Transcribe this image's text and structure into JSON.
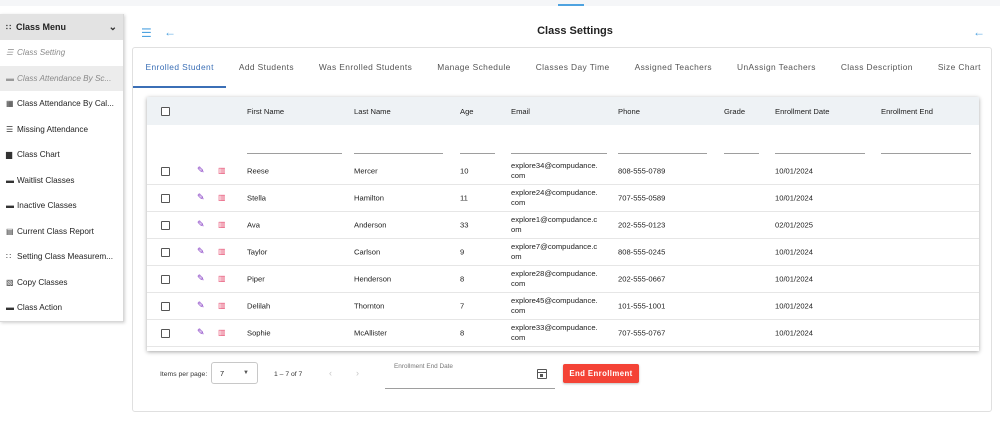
{
  "sidebar": {
    "header": {
      "icon": "grid-icon",
      "label": "Class Menu",
      "chevron": "chevron-down-icon"
    },
    "items": [
      {
        "icon": "list-icon",
        "label": "Class Setting",
        "muted": true
      },
      {
        "icon": "card-icon",
        "label": "Class Attendance By Sc...",
        "muted": true
      },
      {
        "icon": "calendar-icon",
        "label": "Class Attendance By Cal..."
      },
      {
        "icon": "list-icon",
        "label": "Missing Attendance"
      },
      {
        "icon": "bar-chart-icon",
        "label": "Class Chart"
      },
      {
        "icon": "briefcase-icon",
        "label": "Waitlist Classes"
      },
      {
        "icon": "briefcase-icon",
        "label": "Inactive Classes"
      },
      {
        "icon": "document-icon",
        "label": "Current Class Report"
      },
      {
        "icon": "grid-icon",
        "label": "Setting Class Measurem..."
      },
      {
        "icon": "copy-icon",
        "label": "Copy Classes"
      },
      {
        "icon": "folder-icon",
        "label": "Class Action"
      }
    ]
  },
  "header": {
    "title": "Class Settings"
  },
  "tabs": [
    {
      "label": "Enrolled Student",
      "active": true
    },
    {
      "label": "Add Students"
    },
    {
      "label": "Was Enrolled Students"
    },
    {
      "label": "Manage Schedule"
    },
    {
      "label": "Classes Day Time"
    },
    {
      "label": "Assigned Teachers"
    },
    {
      "label": "UnAssign Teachers"
    },
    {
      "label": "Class Description"
    },
    {
      "label": "Size Chart"
    }
  ],
  "table": {
    "columns": [
      "First Name",
      "Last Name",
      "Age",
      "Email",
      "Phone",
      "Grade",
      "Enrollment Date",
      "Enrollment End"
    ],
    "rows": [
      {
        "first": "Reese",
        "last": "Mercer",
        "age": "10",
        "email1": "explore34@compudance.",
        "email2": "com",
        "phone": "808-555-0789",
        "grade": "",
        "date": "10/01/2024",
        "end": ""
      },
      {
        "first": "Stella",
        "last": "Hamilton",
        "age": "11",
        "email1": "explore24@compudance.",
        "email2": "com",
        "phone": "707-555-0589",
        "grade": "",
        "date": "10/01/2024",
        "end": ""
      },
      {
        "first": "Ava",
        "last": "Anderson",
        "age": "33",
        "email1": "explore1@compudance.c",
        "email2": "om",
        "phone": "202-555-0123",
        "grade": "",
        "date": "02/01/2025",
        "end": ""
      },
      {
        "first": "Taylor",
        "last": "Carlson",
        "age": "9",
        "email1": "explore7@compudance.c",
        "email2": "om",
        "phone": "808-555-0245",
        "grade": "",
        "date": "10/01/2024",
        "end": ""
      },
      {
        "first": "Piper",
        "last": "Henderson",
        "age": "8",
        "email1": "explore28@compudance.",
        "email2": "com",
        "phone": "202-555-0667",
        "grade": "",
        "date": "10/01/2024",
        "end": ""
      },
      {
        "first": "Delilah",
        "last": "Thornton",
        "age": "7",
        "email1": "explore45@compudance.",
        "email2": "com",
        "phone": "101-555-1001",
        "grade": "",
        "date": "10/01/2024",
        "end": ""
      },
      {
        "first": "Sophie",
        "last": "McAllister",
        "age": "8",
        "email1": "explore33@compudance.",
        "email2": "com",
        "phone": "707-555-0767",
        "grade": "",
        "date": "10/01/2024",
        "end": ""
      }
    ]
  },
  "footer": {
    "items_per_page_label": "Items per page:",
    "items_per_page_value": "7",
    "range": "1 – 7 of 7",
    "date_label": "Enrollment End Date",
    "end_button": "End Enrollment"
  },
  "colors": {
    "accent": "#4fa3e0",
    "tab_active": "#3b6fb6",
    "danger": "#f44336",
    "edit": "#7b2cbf",
    "delete": "#e5496d"
  }
}
